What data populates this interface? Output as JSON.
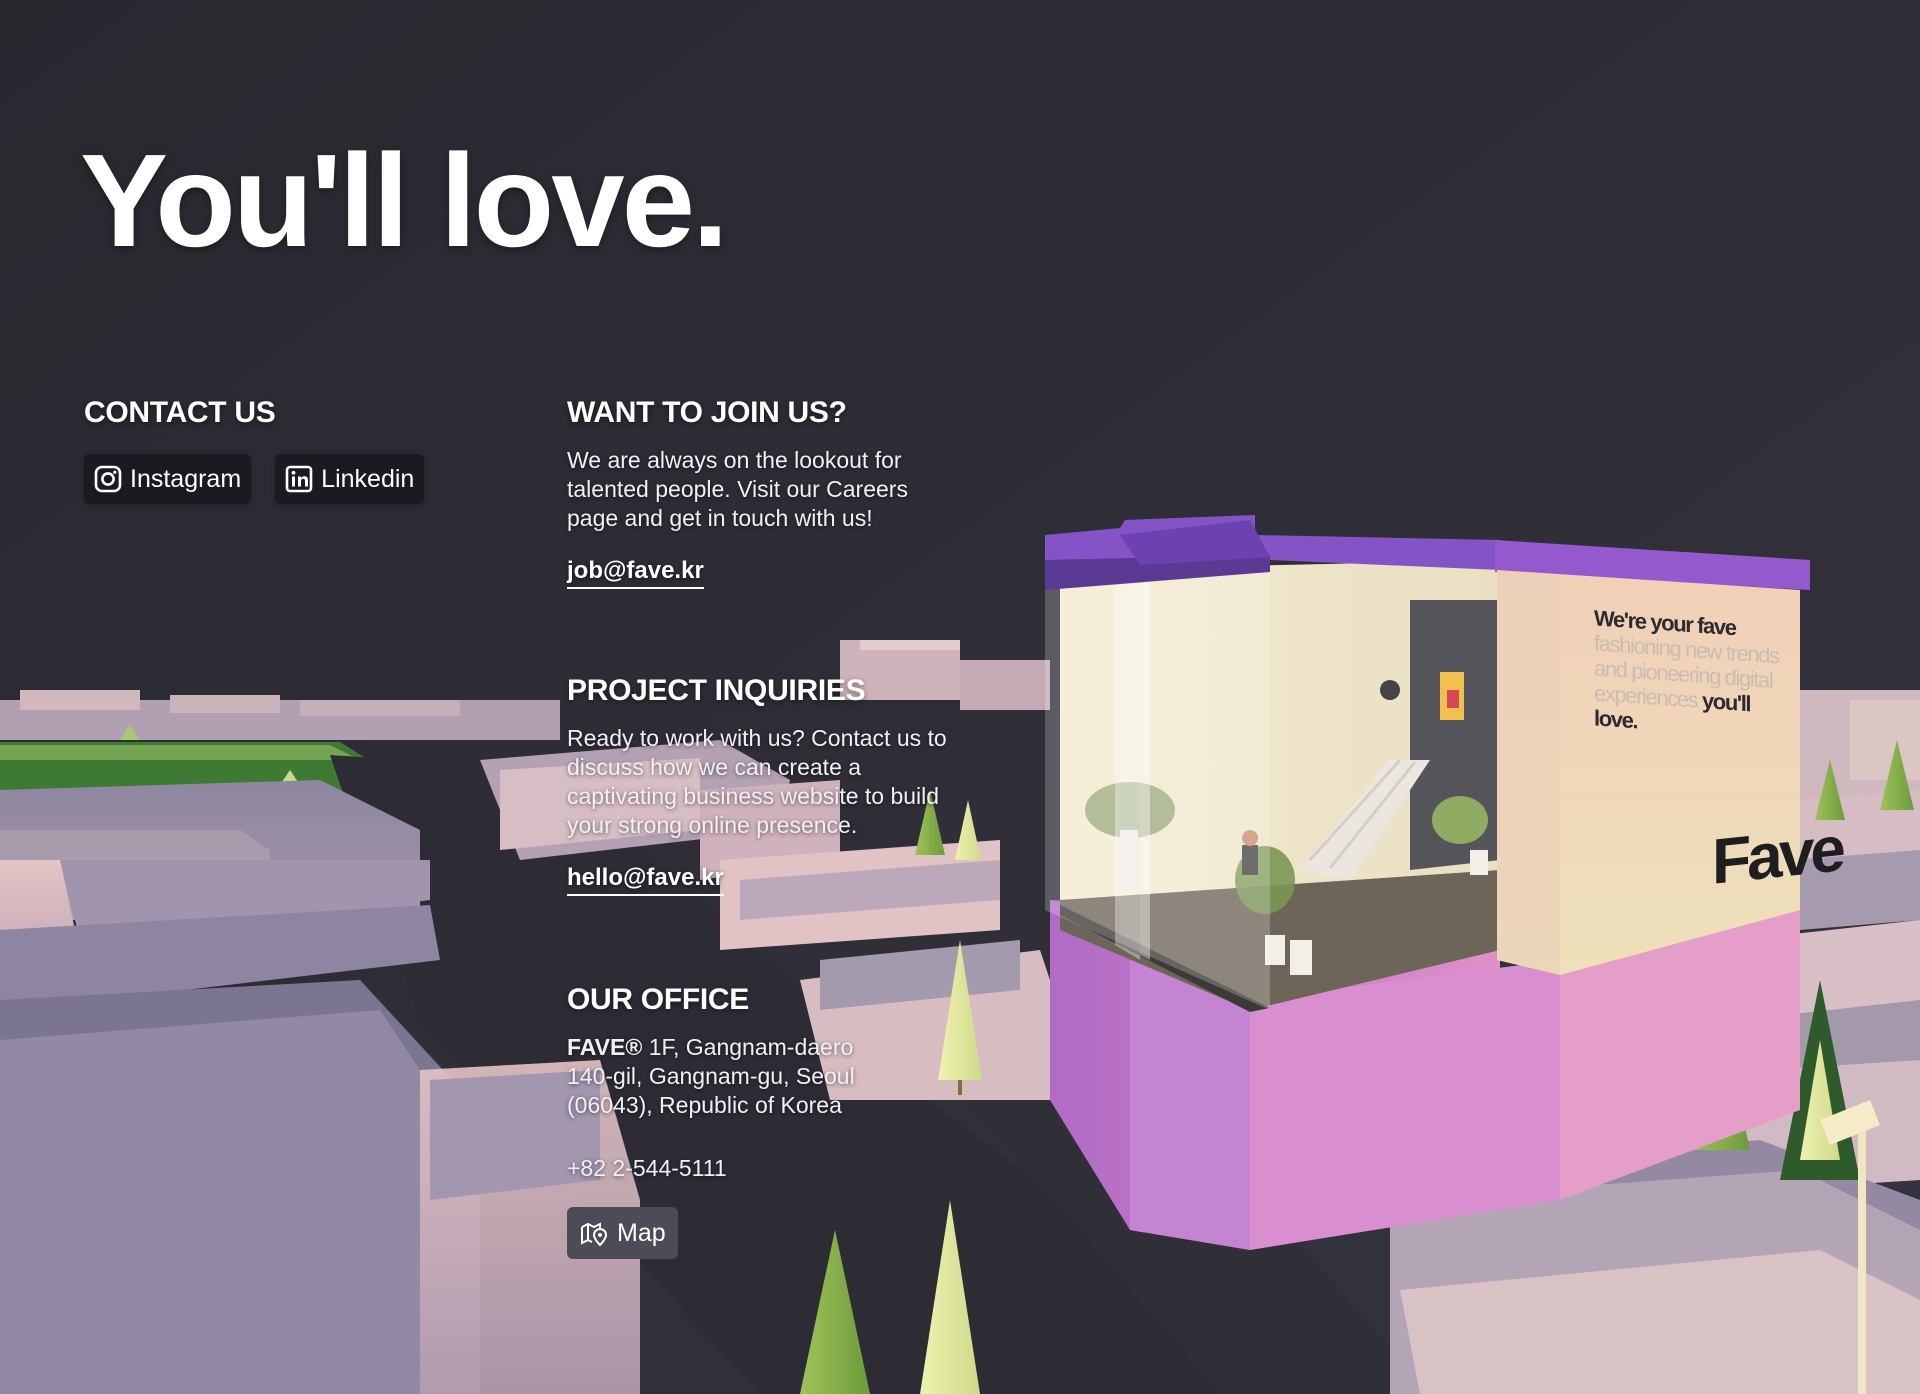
{
  "headline": "You'll love.",
  "contact": {
    "title": "CONTACT US",
    "instagram_label": "Instagram",
    "linkedin_label": "Linkedin",
    "instagram_icon": "instagram-icon",
    "linkedin_icon": "linkedin-icon"
  },
  "join": {
    "title": "WANT TO JOIN US?",
    "text": "We are always on the lookout for talented people. Visit our Careers page and get in touch with us!",
    "email": "job@fave.kr"
  },
  "inquiries": {
    "title": "PROJECT INQUIRIES",
    "text": "Ready to work with us? Contact us to discuss how we can create a captivating business website to build your strong online presence.",
    "email": "hello@fave.kr"
  },
  "office": {
    "title": "OUR OFFICE",
    "brand": "FAVE®",
    "address": " 1F, Gangnam-daero 140-gil, Gangnam-gu, Seoul (06043), Republic of Korea",
    "phone": "+82 2-544-5111",
    "map_label": "Map",
    "map_icon": "map-pin-icon"
  },
  "billboard": {
    "line_strong_1": "We're your fave",
    "line_faded": "fashioning new trends and pioneering digital experiences",
    "line_strong_2": "you'll love.",
    "logo": "Fave"
  },
  "colors": {
    "background": "#2a2932",
    "button_dark": "#1b1a21",
    "button_map": "#4d4b55",
    "roof_purple": "#8a55c9",
    "base_pink": "#c97ad4",
    "billboard": "#efe3c0"
  }
}
